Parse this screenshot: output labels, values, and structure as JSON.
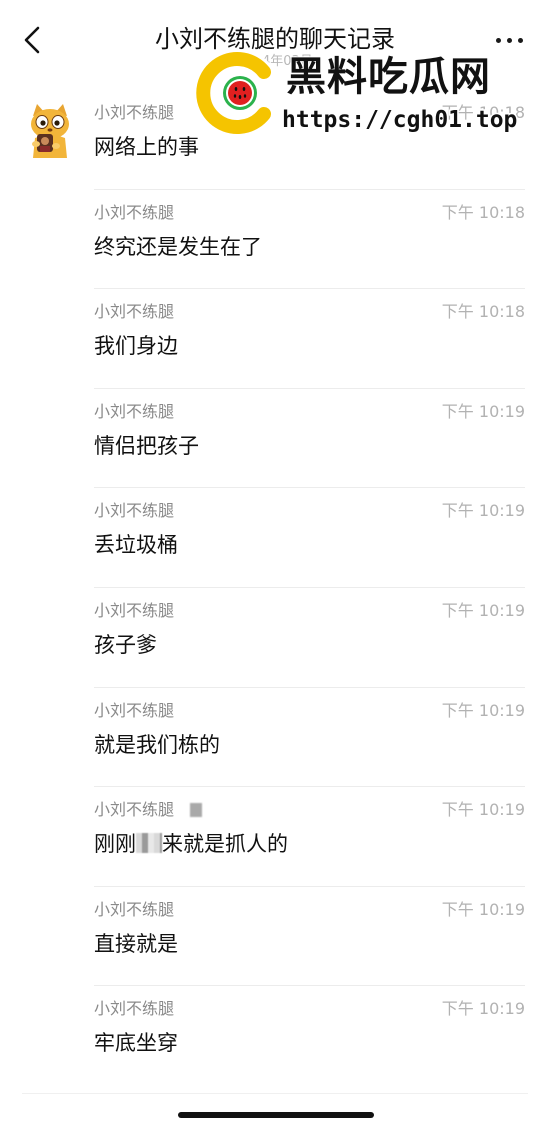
{
  "header": {
    "title": "小刘不练腿的聊天记录",
    "subtitle": "2024年03月",
    "back_icon": "chevron-left-icon",
    "more_icon": "ellipsis-icon"
  },
  "watermark": {
    "name": "黑料吃瓜网",
    "url": "https://cgh01.top",
    "accent_colors": [
      "#f5c400",
      "#e02020",
      "#2bb24c"
    ]
  },
  "messages": [
    {
      "sender": "小刘不练腿",
      "time": "下午 10:18",
      "text": "网络上的事"
    },
    {
      "sender": "小刘不练腿",
      "time": "下午 10:18",
      "text": "终究还是发生在了"
    },
    {
      "sender": "小刘不练腿",
      "time": "下午 10:18",
      "text": "我们身边"
    },
    {
      "sender": "小刘不练腿",
      "time": "下午 10:19",
      "text": "情侣把孩子"
    },
    {
      "sender": "小刘不练腿",
      "time": "下午 10:19",
      "text": "丢垃圾桶"
    },
    {
      "sender": "小刘不练腿",
      "time": "下午 10:19",
      "text": "孩子爹"
    },
    {
      "sender": "小刘不练腿",
      "time": "下午 10:19",
      "text": "就是我们栋的"
    },
    {
      "sender": "小刘不练腿",
      "time": "下午 10:19",
      "text_before": "刚刚",
      "text_after": "来就是抓人的"
    },
    {
      "sender": "小刘不练腿",
      "time": "下午 10:19",
      "text": "直接就是"
    },
    {
      "sender": "小刘不练腿",
      "time": "下午 10:19",
      "text": "牢底坐穿"
    }
  ]
}
